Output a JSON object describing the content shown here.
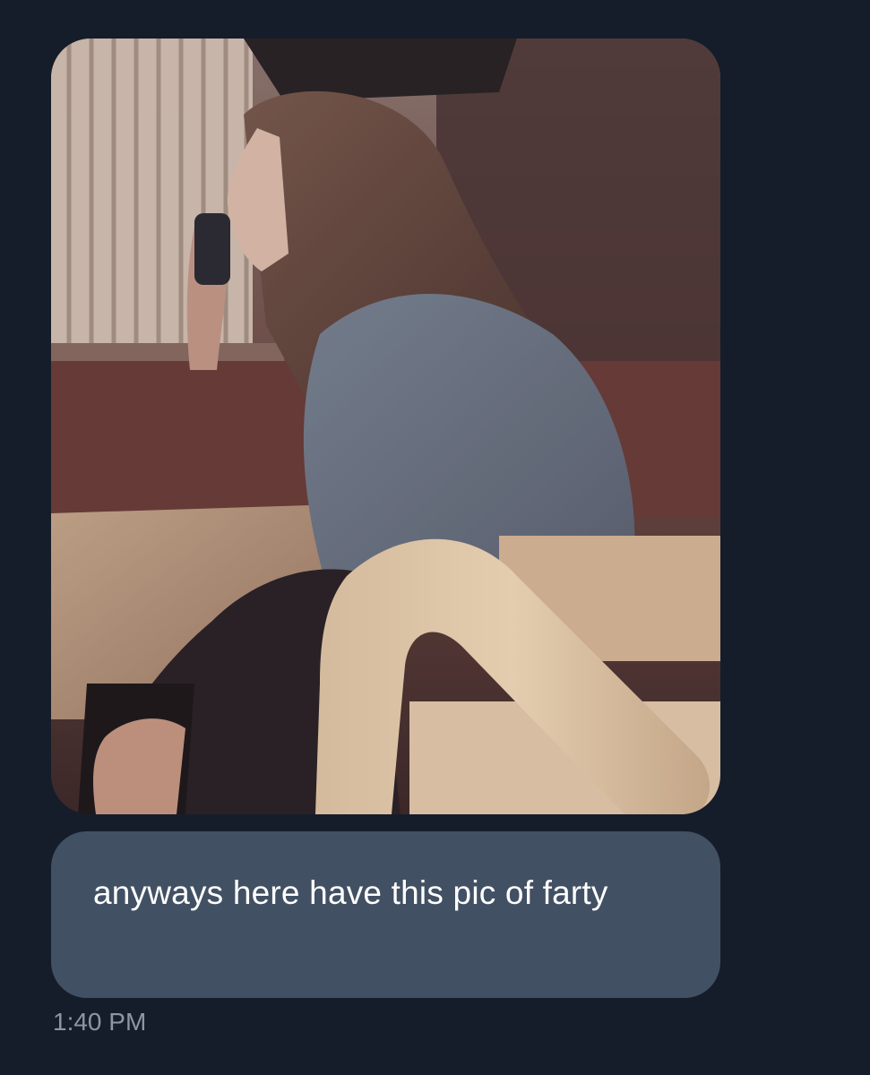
{
  "conversation": {
    "message": {
      "text": "anyways here have this pic of farty",
      "timestamp": "1:40 PM"
    }
  },
  "colors": {
    "background": "#151d2a",
    "bubble": "#425063",
    "message_text": "#ffffff",
    "timestamp_text": "#8b96a6"
  }
}
